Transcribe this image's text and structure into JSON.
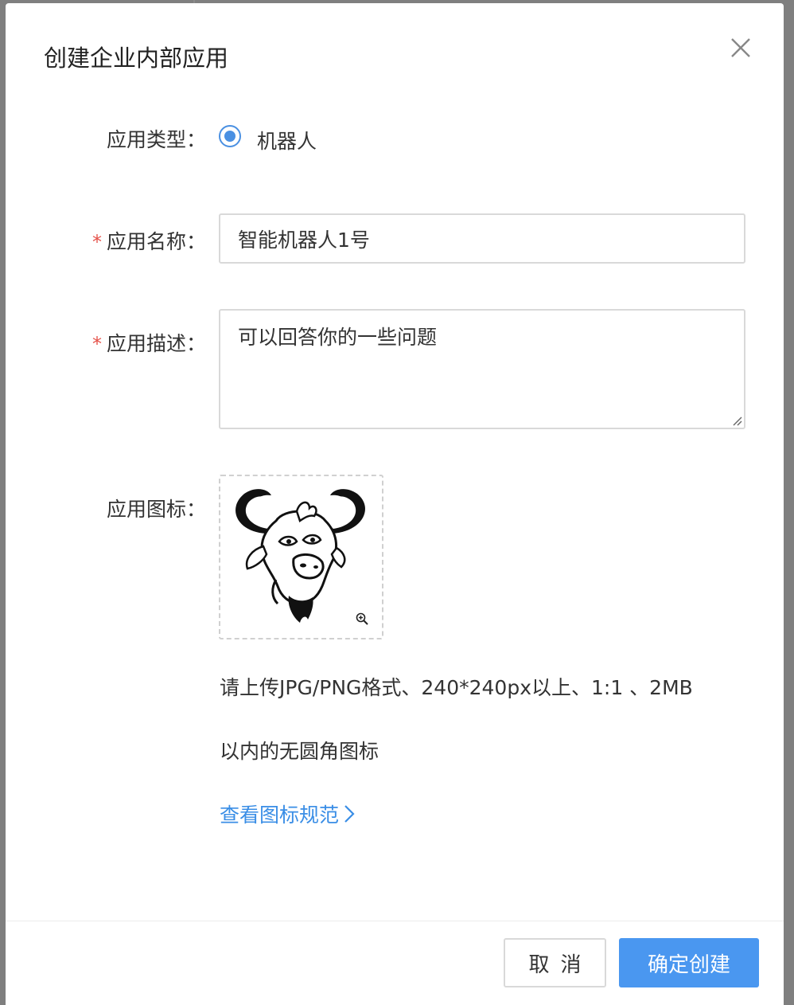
{
  "dialog": {
    "title": "创建企业内部应用"
  },
  "form": {
    "type_label": "应用类型：",
    "type_option": "机器人",
    "name_label": "应用名称：",
    "name_value": "智能机器人1号",
    "desc_label": "应用描述：",
    "desc_value": "可以回答你的一些问题",
    "icon_label": "应用图标：",
    "required_mark": "*",
    "hint_line1": "请上传JPG/PNG格式、240*240px以上、1:1 、2MB",
    "hint_line2": "以内的无圆角图标",
    "link_text": "查看图标规范"
  },
  "footer": {
    "cancel_label": "取消",
    "confirm_label": "确定创建"
  },
  "icons": {
    "close": "close-icon",
    "radio": "radio-selected-icon",
    "chevron": "chevron-right-icon",
    "zoom": "zoom-in-icon",
    "gnu": "gnu-head-logo"
  },
  "colors": {
    "primary": "#4a97f0",
    "link": "#3a8ee6",
    "required": "#e5534b",
    "border": "#d9d9d9"
  }
}
